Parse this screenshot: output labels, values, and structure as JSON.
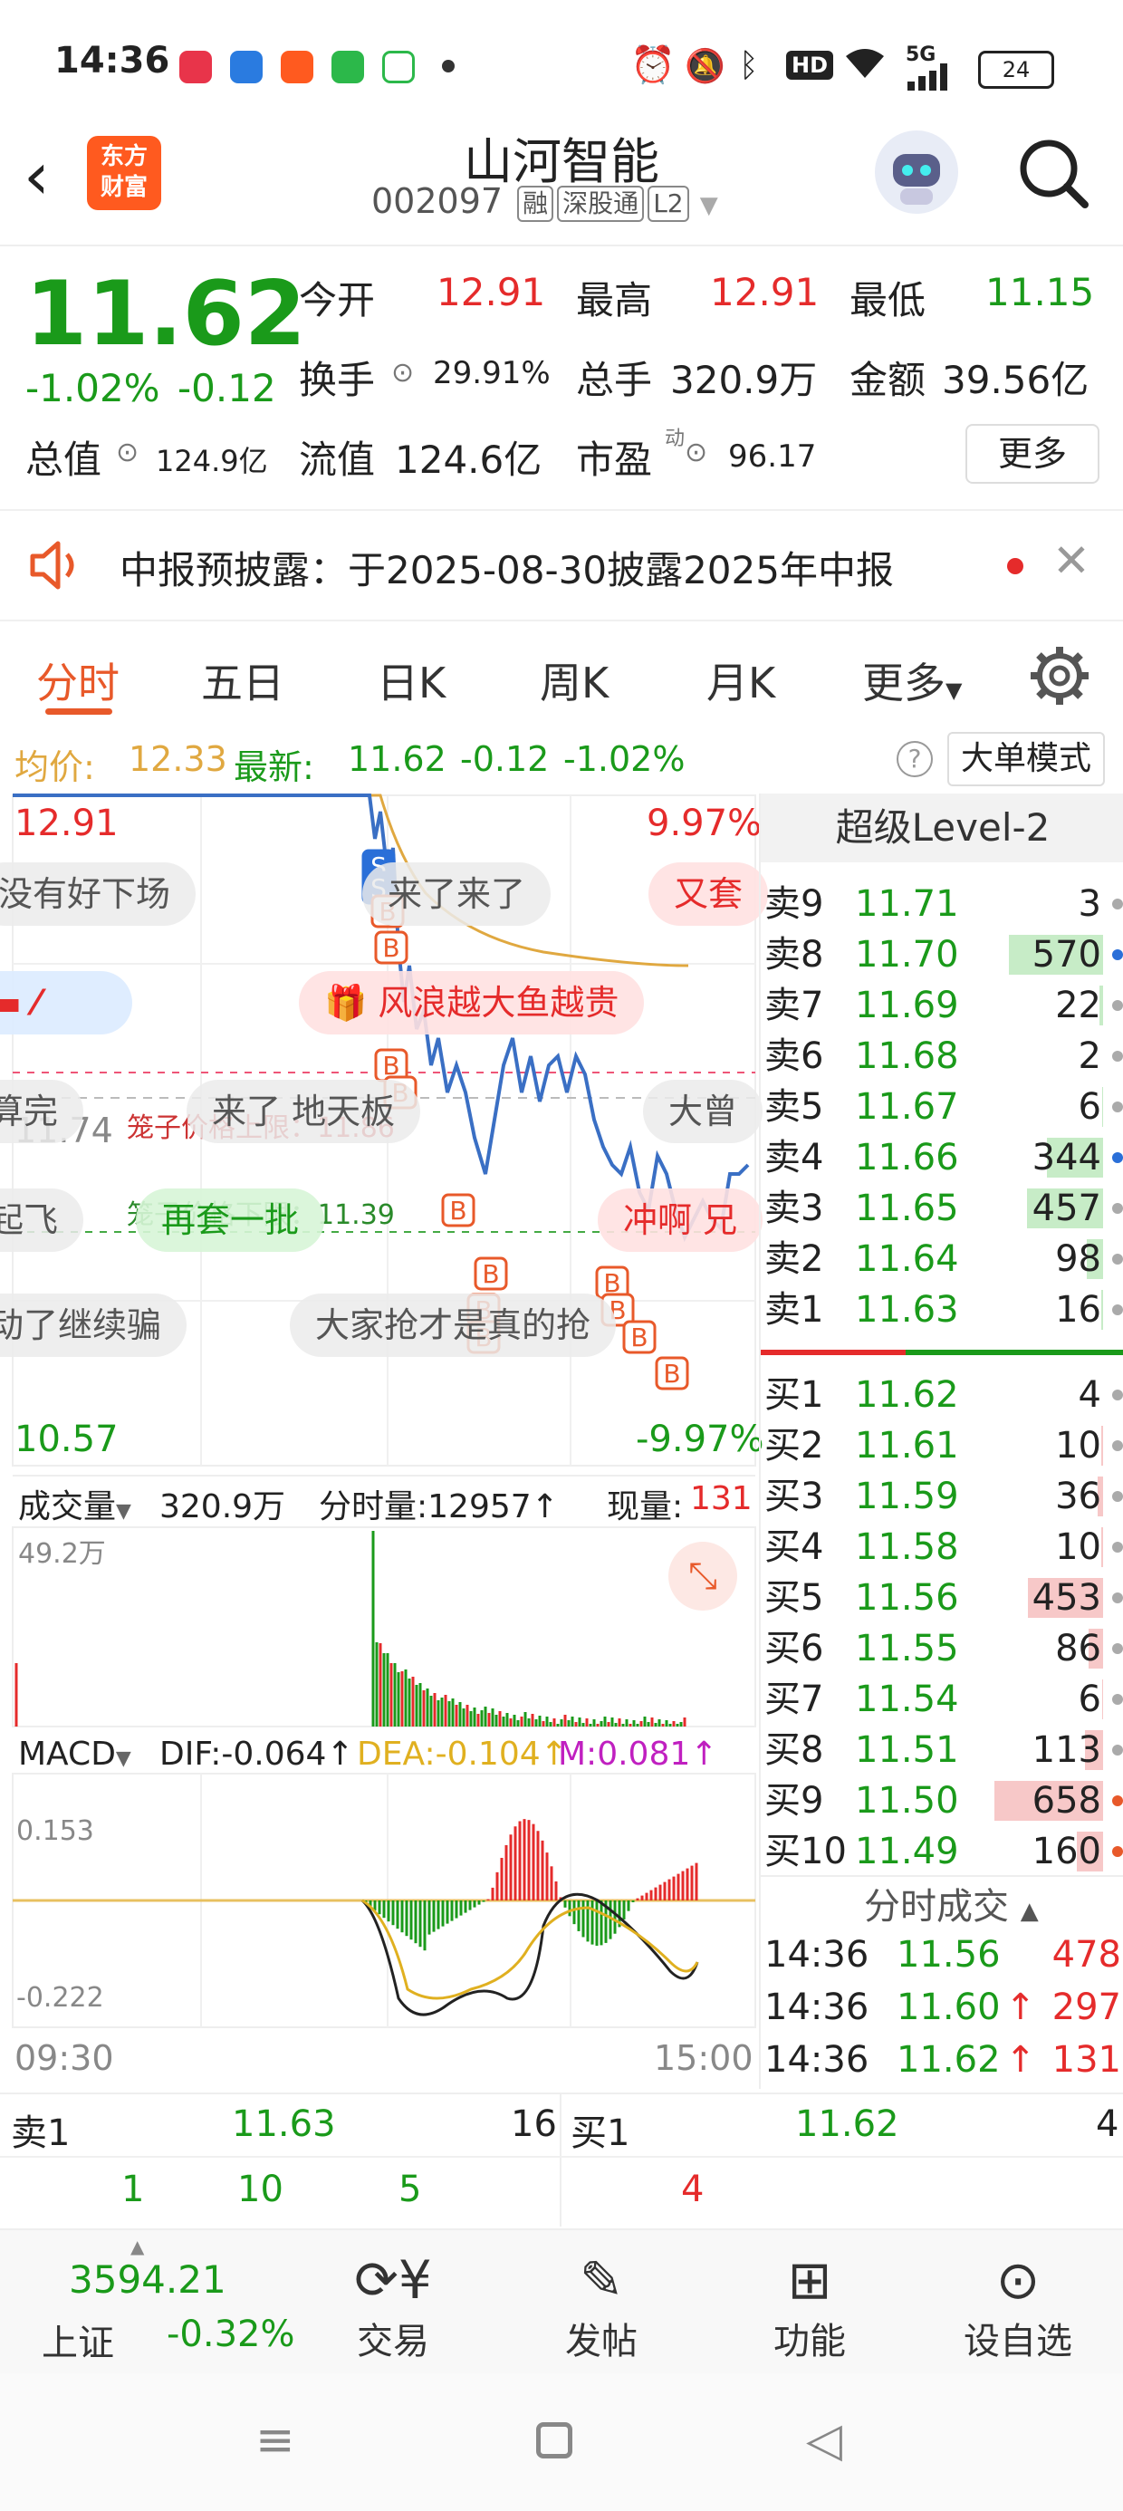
{
  "status_bar": {
    "time": "14:36",
    "network": "5G",
    "battery": "24"
  },
  "header": {
    "logo_text_top": "东方",
    "logo_text_bottom": "财富",
    "title": "山河智能",
    "code": "002097",
    "tags": [
      "融",
      "深股通",
      "L2"
    ]
  },
  "quote": {
    "price": "11.62",
    "change_pct": "-1.02%",
    "change": "-0.12",
    "open_label": "今开",
    "open": "12.91",
    "high_label": "最高",
    "high": "12.91",
    "low_label": "最低",
    "low": "11.15",
    "turnover_label": "换手",
    "turnover": "29.91%",
    "volume_label": "总手",
    "volume": "320.9万",
    "amount_label": "金额",
    "amount": "39.56亿",
    "mktcap_label": "总值",
    "mktcap": "124.9亿",
    "float_label": "流值",
    "float": "124.6亿",
    "pe_label": "市盈",
    "pe_sup": "动",
    "pe": "96.17",
    "more": "更多"
  },
  "notice": {
    "text": "中报预披露：于2025-08-30披露2025年中报"
  },
  "tabs": [
    "分时",
    "五日",
    "日K",
    "周K",
    "月K",
    "更多"
  ],
  "info_line": {
    "avg_label": "均价:",
    "avg": "12.33",
    "latest_label": "最新:",
    "latest": "11.62",
    "change": "-0.12",
    "pct": "-1.02%",
    "mode_button": "大单模式"
  },
  "chart": {
    "y_high": "12.91",
    "y_high_pct": "9.97%",
    "y_low": "10.57",
    "y_low_pct": "-9.97%",
    "prev_close_label": "11.74",
    "upper_limit_label": "笼子价格上限：11.86",
    "lower_limit_label": "笼子价格下限：11.39",
    "danmu": [
      "没有好下场",
      "来了来了",
      "又套",
      "风浪越大鱼越贵",
      "算完",
      "来了 地天板",
      "大曾",
      "起飞",
      "再套一批",
      "冲啊 兄",
      "动了继续骗",
      "大家抢才是真的抢"
    ],
    "volume_label": "成交量",
    "volume_total": "320.9万",
    "minute_volume": "分时量:12957",
    "current_volume_label": "现量:",
    "current_volume": "131",
    "volume_max": "49.2万",
    "macd_label": "MACD",
    "dif": "DIF:-0.064",
    "dea": "DEA:-0.104",
    "m": "M:0.081",
    "macd_top": "0.153",
    "macd_bottom": "-0.222",
    "time_start": "09:30",
    "time_end": "15:00",
    "colors": {
      "price_line": "#3a6fc4",
      "avg_line": "#e0a840",
      "up": "#e52b2b",
      "down": "#1a9a1a"
    }
  },
  "order_book": {
    "header": "超级Level-2",
    "asks": [
      {
        "label": "卖9",
        "price": "11.71",
        "vol": "3",
        "bar": 0,
        "dot": "gray"
      },
      {
        "label": "卖8",
        "price": "11.70",
        "vol": "570",
        "bar": 0.87,
        "dot": "blue"
      },
      {
        "label": "卖7",
        "price": "11.69",
        "vol": "22",
        "bar": 0.03,
        "dot": "gray"
      },
      {
        "label": "卖6",
        "price": "11.68",
        "vol": "2",
        "bar": 0,
        "dot": "gray"
      },
      {
        "label": "卖5",
        "price": "11.67",
        "vol": "6",
        "bar": 0.01,
        "dot": "gray"
      },
      {
        "label": "卖4",
        "price": "11.66",
        "vol": "344",
        "bar": 0.52,
        "dot": "blue"
      },
      {
        "label": "卖3",
        "price": "11.65",
        "vol": "457",
        "bar": 0.7,
        "dot": "gray"
      },
      {
        "label": "卖2",
        "price": "11.64",
        "vol": "98",
        "bar": 0.15,
        "dot": "gray"
      },
      {
        "label": "卖1",
        "price": "11.63",
        "vol": "16",
        "bar": 0.02,
        "dot": "gray"
      }
    ],
    "bids": [
      {
        "label": "买1",
        "price": "11.62",
        "vol": "4",
        "bar": 0,
        "dot": "gray"
      },
      {
        "label": "买2",
        "price": "11.61",
        "vol": "10",
        "bar": 0.02,
        "dot": "gray"
      },
      {
        "label": "买3",
        "price": "11.59",
        "vol": "36",
        "bar": 0.05,
        "dot": "gray"
      },
      {
        "label": "买4",
        "price": "11.58",
        "vol": "10",
        "bar": 0.02,
        "dot": "gray"
      },
      {
        "label": "买5",
        "price": "11.56",
        "vol": "453",
        "bar": 0.69,
        "dot": "gray"
      },
      {
        "label": "买6",
        "price": "11.55",
        "vol": "86",
        "bar": 0.13,
        "dot": "gray"
      },
      {
        "label": "买7",
        "price": "11.54",
        "vol": "6",
        "bar": 0.01,
        "dot": "gray"
      },
      {
        "label": "买8",
        "price": "11.51",
        "vol": "113",
        "bar": 0.17,
        "dot": "gray"
      },
      {
        "label": "买9",
        "price": "11.50",
        "vol": "658",
        "bar": 1.0,
        "dot": "orange"
      },
      {
        "label": "买10",
        "price": "11.49",
        "vol": "160",
        "bar": 0.24,
        "dot": "orange"
      }
    ],
    "trades_header": "分时成交",
    "trades": [
      {
        "time": "14:36",
        "price": "11.56",
        "arrow": "",
        "vol": "478"
      },
      {
        "time": "14:36",
        "price": "11.60",
        "arrow": "↑",
        "vol": "297"
      },
      {
        "time": "14:36",
        "price": "11.62",
        "arrow": "↑",
        "vol": "131"
      }
    ]
  },
  "summary": {
    "sell_label": "卖1",
    "sell_price": "11.63",
    "sell_vol": "16",
    "buy_label": "买1",
    "buy_price": "11.62",
    "buy_vol": "4",
    "row2": [
      "1",
      "10",
      "5",
      "4"
    ]
  },
  "bottom_nav": {
    "index_value": "3594.21",
    "index_name": "上证",
    "index_pct": "-0.32%",
    "items": [
      "交易",
      "发帖",
      "功能",
      "设自选"
    ]
  }
}
